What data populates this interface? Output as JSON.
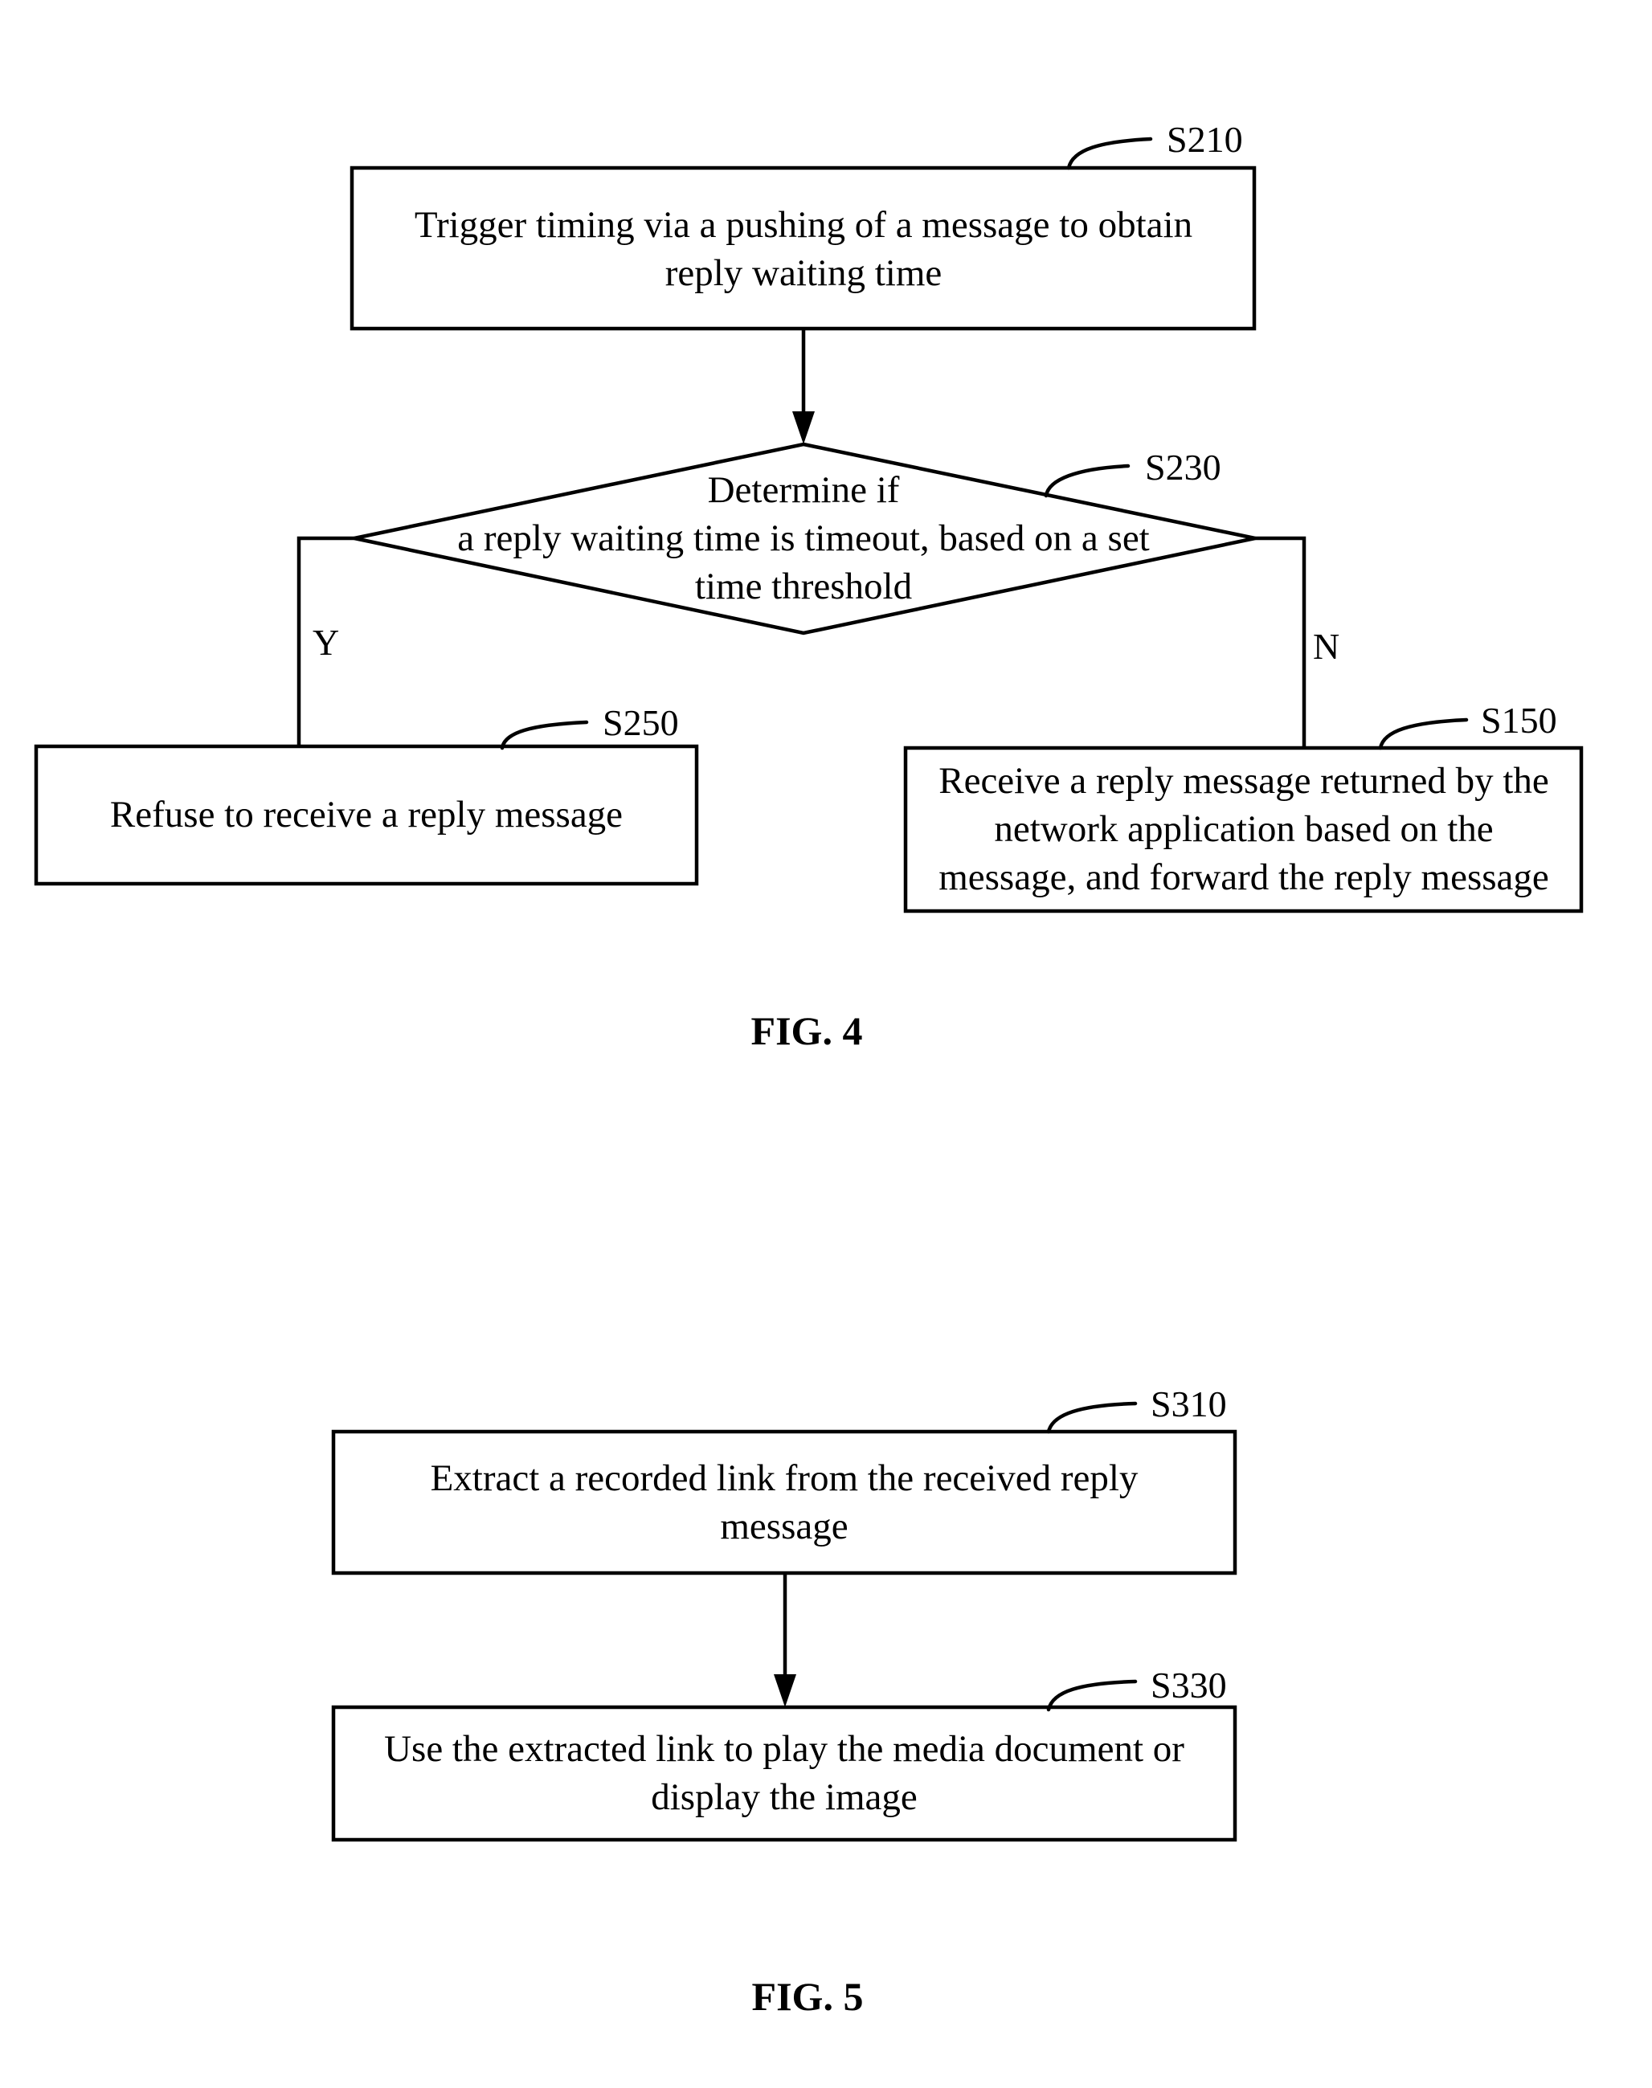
{
  "figures": [
    {
      "caption": "FIG. 4",
      "nodes": {
        "s210": {
          "id": "S210",
          "type": "process",
          "lines": [
            "Trigger timing via a pushing of a message to obtain",
            "reply waiting time"
          ]
        },
        "s230": {
          "id": "S230",
          "type": "decision",
          "lines": [
            "Determine if",
            "a reply waiting time is timeout, based on a set",
            "time threshold"
          ]
        },
        "s250": {
          "id": "S250",
          "type": "process",
          "lines": [
            "Refuse to receive a reply message"
          ]
        },
        "s150": {
          "id": "S150",
          "type": "process",
          "lines": [
            "Receive a reply message returned by the",
            "network application based on the",
            "message, and forward the reply message"
          ]
        }
      },
      "edges": [
        {
          "from": "S210",
          "to": "S230",
          "label": ""
        },
        {
          "from": "S230",
          "to": "S250",
          "label": "Y"
        },
        {
          "from": "S230",
          "to": "S150",
          "label": "N"
        }
      ]
    },
    {
      "caption": "FIG. 5",
      "nodes": {
        "s310": {
          "id": "S310",
          "type": "process",
          "lines": [
            "Extract a recorded link from the received reply",
            "message"
          ]
        },
        "s330": {
          "id": "S330",
          "type": "process",
          "lines": [
            "Use the extracted link to play the media document or",
            "display the image"
          ]
        }
      },
      "edges": [
        {
          "from": "S310",
          "to": "S330",
          "label": ""
        }
      ]
    }
  ]
}
